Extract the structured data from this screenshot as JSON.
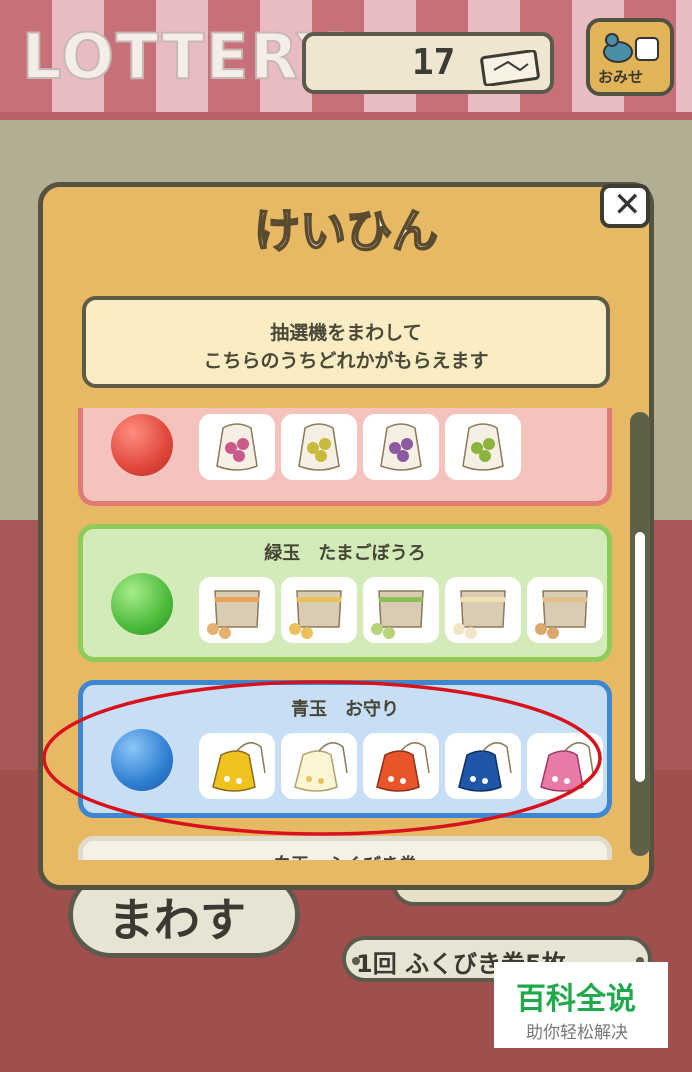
{
  "header": {
    "title": "LOTTERY",
    "ticket_count": "17",
    "shop_label": "おみせ"
  },
  "modal": {
    "title": "けいひん",
    "close_label": "✕",
    "info_line1": "抽選機をまわして",
    "info_line2": "こちらのうちどれかがもらえます",
    "prizes": [
      {
        "name": "",
        "ball_color": "#e0473c",
        "item_colors": [
          "#c95b8a",
          "#c9b93c",
          "#8c5aa0",
          "#8cb43c"
        ]
      },
      {
        "name": "緑玉　たまごぼうろ",
        "ball_color": "#4cbb3c",
        "item_colors": [
          "#e8a25a",
          "#e8c15a",
          "#8cbf5a",
          "#efe0b0",
          "#e2c08e"
        ]
      },
      {
        "name": "青玉　お守り",
        "ball_color": "#2f7fd2",
        "item_colors": [
          "#f0c21e",
          "#fbf5d4",
          "#e8552a",
          "#1f56a8",
          "#e87aa8"
        ]
      },
      {
        "name": "白玉　ふくびき券"
      }
    ]
  },
  "footer": {
    "spin_label": "まわす",
    "cost_label": "1回 ふくびき券5枚"
  },
  "watermark": {
    "main": "百科全说",
    "sub": "助你轻松解决"
  },
  "colors": {
    "annotation": "#d8121c",
    "modal_bg": "#e7b964"
  }
}
